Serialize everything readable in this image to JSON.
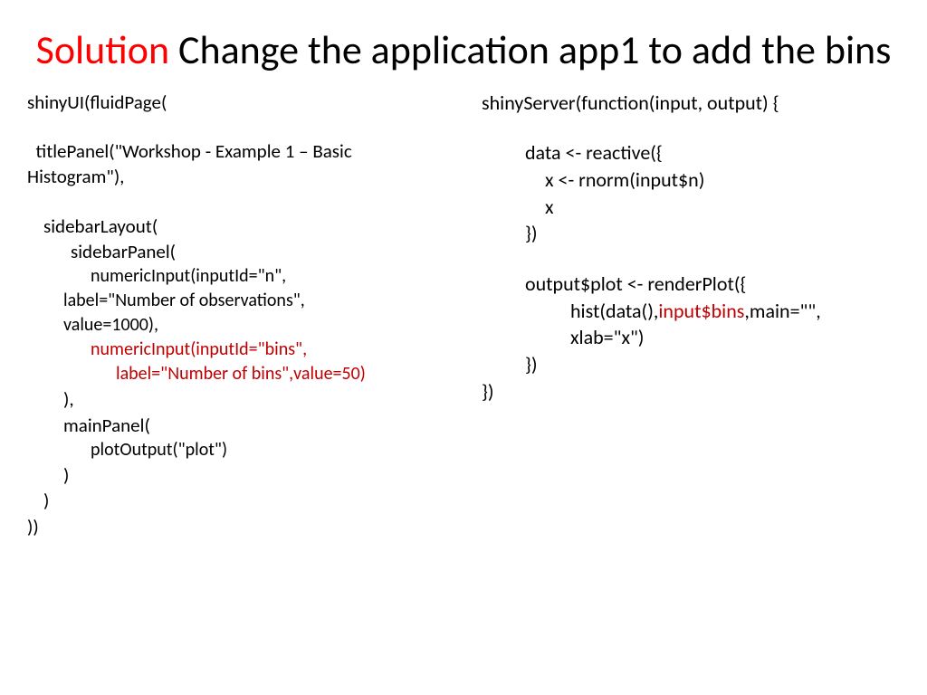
{
  "title": {
    "redWord": "Solution",
    "rest": " Change the application app1 to add the bins"
  },
  "left": {
    "l1": "shinyUI(fluidPage(",
    "l2a": "  titlePanel(\"Workshop - Example 1 – Basic",
    "l2b": "Histogram\"),",
    "l3": "sidebarLayout(",
    "l4": "sidebarPanel(",
    "l5": "numericInput(inputId=\"n\",",
    "l6": "label=\"Number of observations\",",
    "l7": "value=1000),",
    "l8": "numericInput(inputId=\"bins\",",
    "l9": "label=\"Number of bins\",value=50)",
    "l10": "),",
    "l11": "mainPanel(",
    "l12": "plotOutput(\"plot\")",
    "l13": ")",
    "l14": ")",
    "l15": "))"
  },
  "right": {
    "r1": "shinyServer(function(input, output) {",
    "r2": "data <- reactive({",
    "r3": "x <- rnorm(input$n)",
    "r4": "x",
    "r5": "})",
    "r6": "output$plot <- renderPlot({",
    "r7a": "hist(data(),",
    "r7red": "input$bins",
    "r7b": ",main=\"\",",
    "r8": "xlab=\"x\")",
    "r9": "})",
    "r10": "})"
  }
}
